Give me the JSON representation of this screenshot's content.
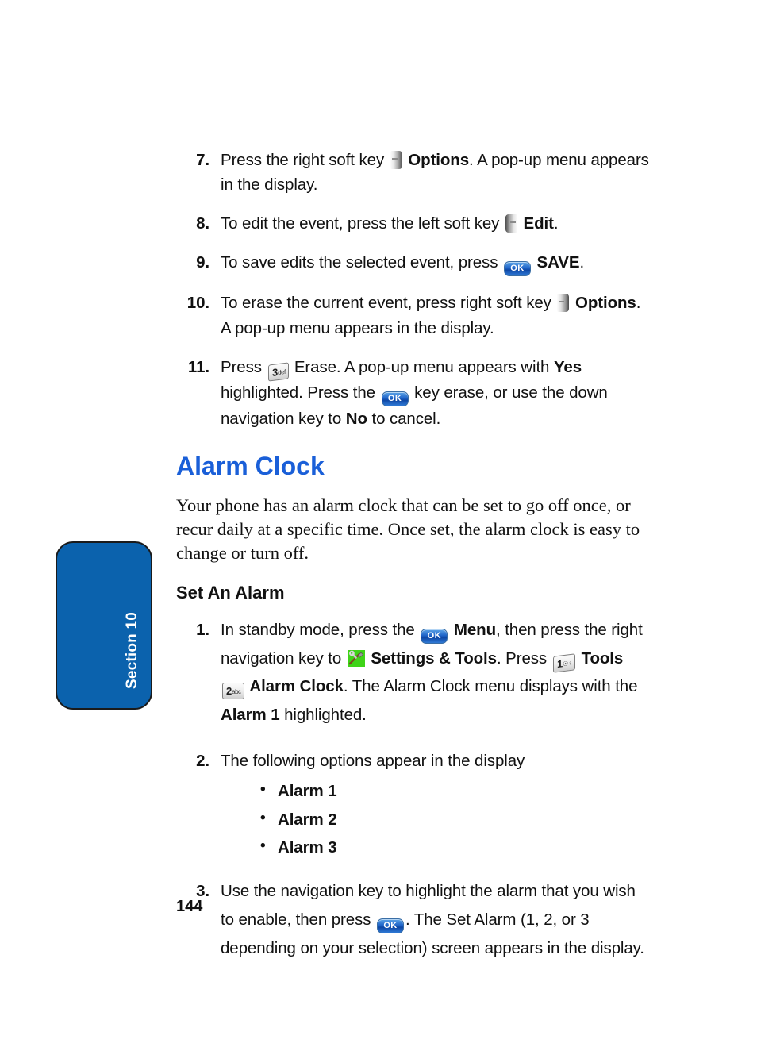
{
  "page": {
    "number": "144",
    "section_tab_label": "Section 10",
    "accent_blue": "#1a5fd8",
    "tab_blue": "#0b62ad"
  },
  "icons": {
    "ok_key": "OK",
    "key_1_digit": "1",
    "key_1_sub": "☉♀",
    "key_2_digit": "2",
    "key_2_sub": "abc",
    "key_3_digit": "3",
    "key_3_sub": "def"
  },
  "steps_top": [
    {
      "number": "7.",
      "parts": [
        {
          "t": "text",
          "v": "Press the right soft key "
        },
        {
          "t": "icon",
          "v": "soft-key-right"
        },
        {
          "t": "bold",
          "v": " Options"
        },
        {
          "t": "text",
          "v": ". A pop-up menu appears in the display."
        }
      ]
    },
    {
      "number": "8.",
      "parts": [
        {
          "t": "text",
          "v": "To edit the event, press the left soft key "
        },
        {
          "t": "icon",
          "v": "soft-key-left"
        },
        {
          "t": "bold",
          "v": " Edit"
        },
        {
          "t": "text",
          "v": "."
        }
      ]
    },
    {
      "number": "9.",
      "parts": [
        {
          "t": "text",
          "v": "To save edits the selected event, press "
        },
        {
          "t": "icon",
          "v": "ok-key"
        },
        {
          "t": "bold",
          "v": " SAVE"
        },
        {
          "t": "text",
          "v": "."
        }
      ]
    },
    {
      "number": "10.",
      "parts": [
        {
          "t": "text",
          "v": "To erase the current event, press right soft key "
        },
        {
          "t": "icon",
          "v": "soft-key-right"
        },
        {
          "t": "bold",
          "v": " Options"
        },
        {
          "t": "text",
          "v": ". A pop-up menu appears in the display."
        }
      ]
    },
    {
      "number": "11.",
      "parts": [
        {
          "t": "text",
          "v": "Press "
        },
        {
          "t": "icon",
          "v": "key-3-def"
        },
        {
          "t": "text",
          "v": " Erase. A pop-up menu appears with "
        },
        {
          "t": "bold",
          "v": "Yes"
        },
        {
          "t": "text",
          "v": " highlighted. Press the "
        },
        {
          "t": "icon",
          "v": "ok-key"
        },
        {
          "t": "text",
          "v": " key erase, or use the down navigation key to "
        },
        {
          "t": "bold",
          "v": "No"
        },
        {
          "t": "text",
          "v": " to cancel."
        }
      ]
    }
  ],
  "chapter": {
    "heading": "Alarm Clock",
    "intro": "Your phone has an alarm clock that can be set to go off once, or recur daily at a specific time. Once set, the alarm clock is easy to change or turn off.",
    "subheading": "Set An Alarm"
  },
  "steps_bottom": [
    {
      "number": "1.",
      "parts": [
        {
          "t": "text",
          "v": "In standby mode, press the "
        },
        {
          "t": "icon",
          "v": "ok-key"
        },
        {
          "t": "bold",
          "v": " Menu"
        },
        {
          "t": "text",
          "v": ", then press the right navigation key to "
        },
        {
          "t": "icon",
          "v": "settings-tools-icon"
        },
        {
          "t": "bold",
          "v": " Settings & Tools"
        },
        {
          "t": "text",
          "v": ". Press "
        },
        {
          "t": "icon",
          "v": "key-1"
        },
        {
          "t": "bold",
          "v": " Tools "
        },
        {
          "t": "icon",
          "v": "key-2-abc"
        },
        {
          "t": "bold",
          "v": " Alarm Clock"
        },
        {
          "t": "text",
          "v": ". The Alarm Clock menu displays with the "
        },
        {
          "t": "bold",
          "v": "Alarm 1"
        },
        {
          "t": "text",
          "v": " highlighted."
        }
      ]
    },
    {
      "number": "2.",
      "parts": [
        {
          "t": "text",
          "v": " The following options appear in the display"
        }
      ],
      "bullets": [
        "Alarm 1",
        "Alarm 2",
        "Alarm 3"
      ]
    },
    {
      "number": "3.",
      "parts": [
        {
          "t": "text",
          "v": "Use the navigation key to highlight the alarm that you wish to enable, then press "
        },
        {
          "t": "icon",
          "v": "ok-key"
        },
        {
          "t": "text",
          "v": ". The Set Alarm (1, 2, or 3 depending on your selection) screen appears in the display."
        }
      ]
    }
  ]
}
